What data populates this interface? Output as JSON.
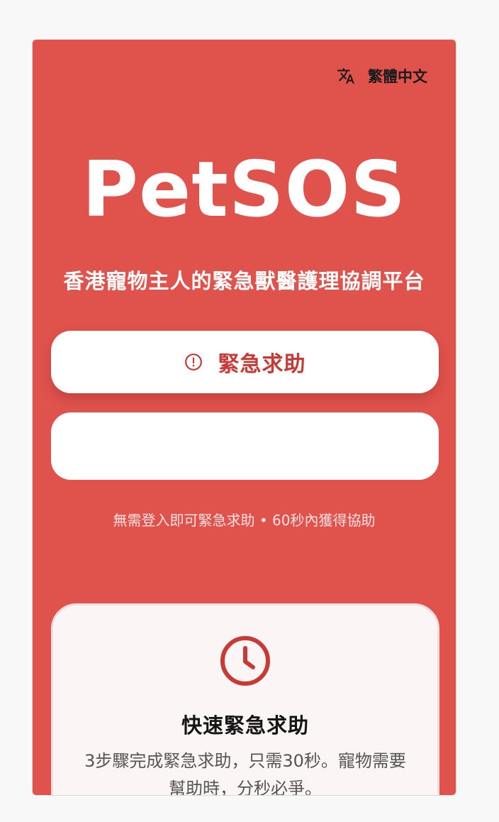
{
  "header": {
    "language_label": "繁體中文",
    "language_icon": "translate-icon"
  },
  "hero": {
    "title": "PetSOS",
    "subtitle": "香港寵物主人的緊急獸醫護理協調平台"
  },
  "actions": {
    "emergency_label": "緊急求助",
    "emergency_icon": "alert-circle-icon",
    "secondary_label": ""
  },
  "hint": "無需登入即可緊急求助 • 60秒內獲得協助",
  "features": [
    {
      "icon": "clock-icon",
      "title": "快速緊急求助",
      "description": "3步驟完成緊急求助，只需30秒。寵物需要幫助時，分秒必爭。"
    }
  ],
  "colors": {
    "brand_red": "#e0534d",
    "accent_red": "#c83a35",
    "card_background": "#fbf5f5"
  }
}
